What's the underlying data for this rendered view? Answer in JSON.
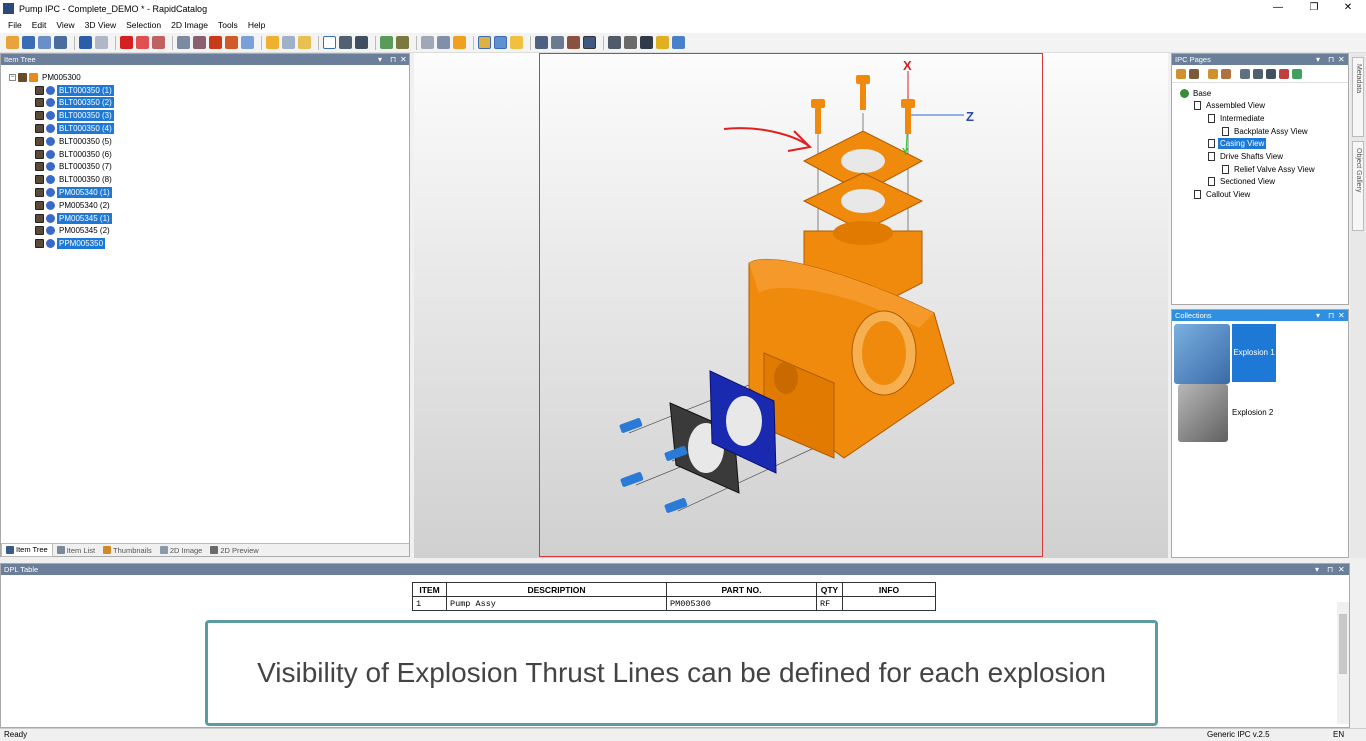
{
  "window": {
    "title": "Pump IPC - Complete_DEMO * - RapidCatalog"
  },
  "menu": [
    "File",
    "Edit",
    "View",
    "3D View",
    "Selection",
    "2D Image",
    "Tools",
    "Help"
  ],
  "item_tree": {
    "title": "Item Tree",
    "root": "PM005300",
    "items": [
      {
        "label": "BLT000350 (1)",
        "selected": true
      },
      {
        "label": "BLT000350 (2)",
        "selected": true
      },
      {
        "label": "BLT000350 (3)",
        "selected": true
      },
      {
        "label": "BLT000350 (4)",
        "selected": true
      },
      {
        "label": "BLT000350 (5)",
        "selected": false
      },
      {
        "label": "BLT000350 (6)",
        "selected": false
      },
      {
        "label": "BLT000350 (7)",
        "selected": false
      },
      {
        "label": "BLT000350 (8)",
        "selected": false
      },
      {
        "label": "PM005340 (1)",
        "selected": true
      },
      {
        "label": "PM005340 (2)",
        "selected": false
      },
      {
        "label": "PM005345 (1)",
        "selected": true
      },
      {
        "label": "PM005345 (2)",
        "selected": false
      },
      {
        "label": "PPM005350",
        "selected": true
      }
    ],
    "tabs": [
      "Item Tree",
      "Item List",
      "Thumbnails",
      "2D Image",
      "2D Preview"
    ]
  },
  "viewport": {
    "axis_x": "X",
    "axis_y": "Y",
    "axis_z": "Z"
  },
  "ipc_pages": {
    "title": "IPC Pages",
    "items": [
      {
        "label": "Base",
        "selected": false
      },
      {
        "label": "Assembled View",
        "selected": false
      },
      {
        "label": "Intermediate",
        "selected": false
      },
      {
        "label": "Backplate Assy View",
        "selected": false
      },
      {
        "label": "Casing View",
        "selected": true
      },
      {
        "label": "Drive Shafts View",
        "selected": false
      },
      {
        "label": "Relief Valve Assy View",
        "selected": false
      },
      {
        "label": "Sectioned View",
        "selected": false
      },
      {
        "label": "Callout View",
        "selected": false
      }
    ]
  },
  "collections": {
    "title": "Collections",
    "items": [
      {
        "label": "Explosion 1",
        "selected": true
      },
      {
        "label": "Explosion 2",
        "selected": false
      }
    ]
  },
  "side_tabs": [
    "Metadata",
    "Object Gallery"
  ],
  "dpl_table": {
    "title": "DPL Table",
    "headers": [
      "ITEM",
      "DESCRIPTION",
      "PART NO.",
      "QTY",
      "INFO"
    ],
    "rows": [
      [
        "1",
        "Pump Assy",
        "PM005300",
        "RF",
        ""
      ]
    ]
  },
  "caption": "Visibility of Explosion Thrust Lines can be defined for each explosion",
  "status": {
    "left": "Ready",
    "version": "Generic IPC v.2.5",
    "lang": "EN"
  },
  "colors": {
    "selection": "#1e78d6",
    "panel_header": "#6b7f9b",
    "active_header": "#2f8fe0",
    "part_orange": "#f08a0c",
    "viewport_border": "#d43a3a"
  }
}
